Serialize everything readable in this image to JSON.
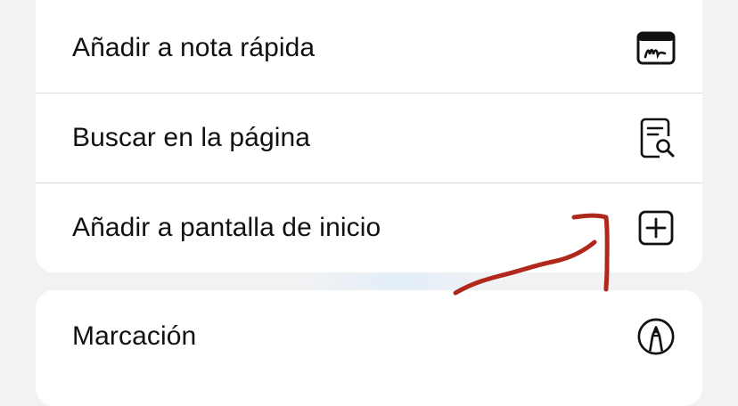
{
  "menu": {
    "items": [
      {
        "label": "Añadir a nota rápida",
        "icon": "quick-note-icon"
      },
      {
        "label": "Buscar en la página",
        "icon": "find-on-page-icon"
      },
      {
        "label": "Añadir a pantalla de inicio",
        "icon": "add-square-icon"
      }
    ],
    "second_group": [
      {
        "label": "Marcación",
        "icon": "markup-icon"
      }
    ]
  },
  "annotation": {
    "color": "#b0281c"
  }
}
